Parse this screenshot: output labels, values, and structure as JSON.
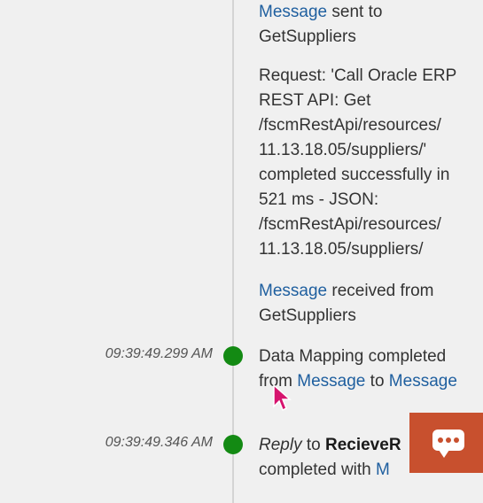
{
  "entries": [
    {
      "link": "Message",
      "text": " sent to GetSuppliers"
    },
    {
      "text": "Request: 'Call Oracle ERP REST API: Get /fscmRestApi/resources/ 11.13.18.05/suppliers/' completed successfully in 521 ms - JSON: /fscmRestApi/resources/ 11.13.18.05/suppliers/"
    },
    {
      "link": "Message",
      "text": " received from GetSuppliers"
    },
    {
      "timestamp": "09:39:49.299 AM",
      "text_a": "Data Mapping completed from ",
      "link_a": "Message",
      "text_b": " to ",
      "link_b": "Message"
    },
    {
      "timestamp": "09:39:49.346 AM",
      "italic": "Reply",
      "text_a": " to ",
      "bold": "RecieveR",
      "text_b": " completed with ",
      "link": "M"
    }
  ],
  "colors": {
    "link": "#1f5f9f",
    "status_dot": "#138a13",
    "chat_button": "#c8502e"
  },
  "icons": {
    "chat": "chat-bubble-icon",
    "cursor": "mouse-pointer-icon"
  }
}
